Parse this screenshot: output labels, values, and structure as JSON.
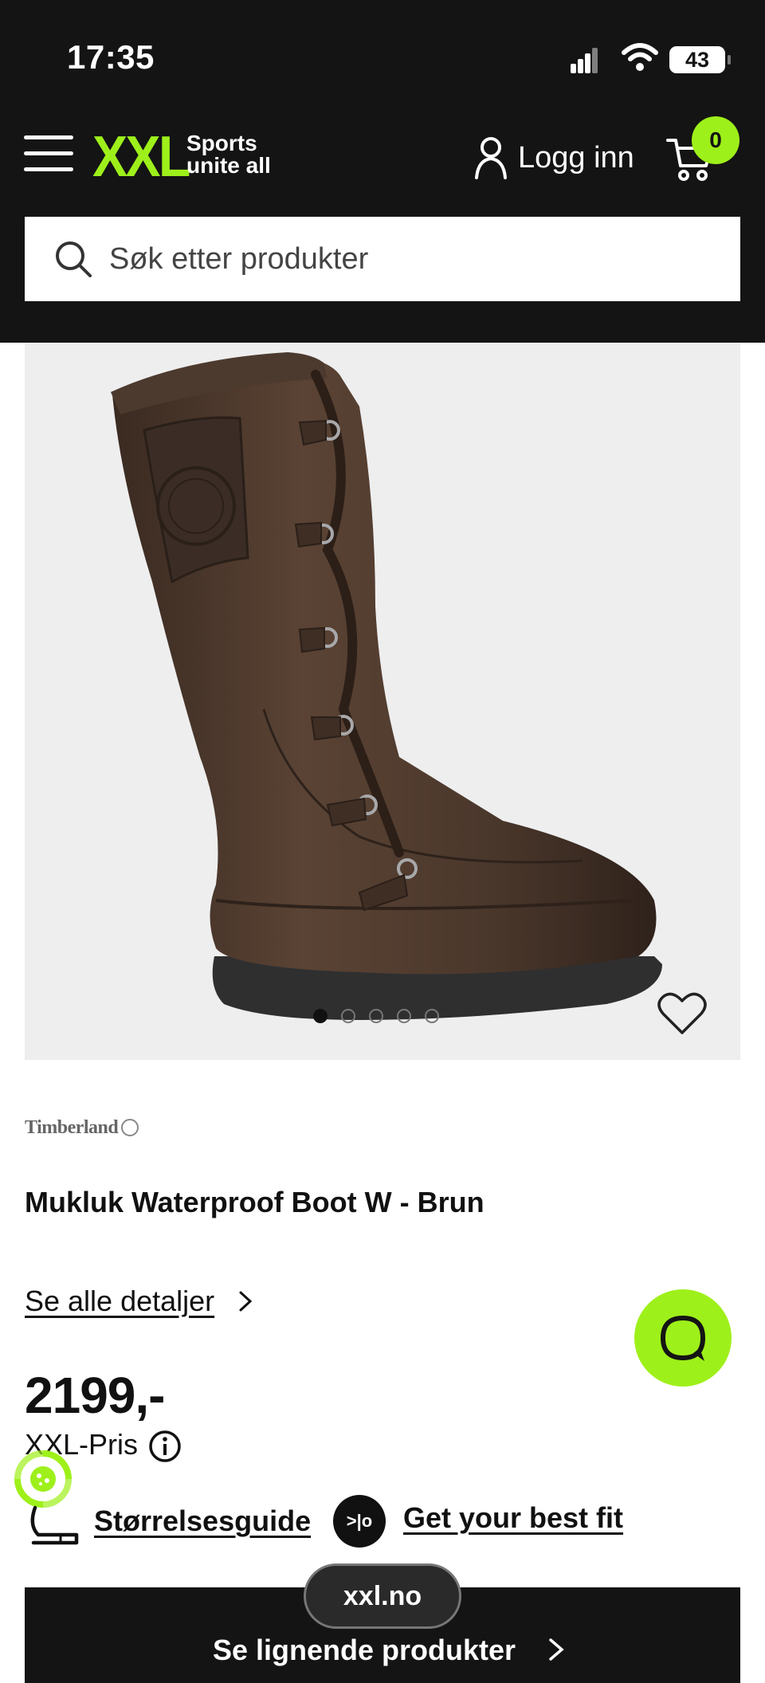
{
  "status_bar": {
    "time": "17:35",
    "battery": "43"
  },
  "header": {
    "brand": "XXL",
    "tagline_line1": "Sports",
    "tagline_line2": "unite all",
    "login_label": "Logg inn",
    "cart_count": "0",
    "search_placeholder": "Søk etter produkter"
  },
  "gallery": {
    "image_count": 5,
    "active_index": 0
  },
  "product": {
    "brand_logo_text": "Timberland",
    "title": "Mukluk Waterproof Boot W - Brun",
    "details_link": "Se alle detaljer",
    "price": "2199,-",
    "price_label": "XXL-Pris",
    "size_guide": "Størrelsesguide",
    "fit_icon_text": ">|o",
    "fit_link": "Get your best fit",
    "similar_button": "Se lignende produkter"
  },
  "browser": {
    "url": "xxl.no"
  },
  "colors": {
    "accent": "#9ef01a",
    "header_bg": "#141414",
    "image_bg": "#eeeeef"
  }
}
